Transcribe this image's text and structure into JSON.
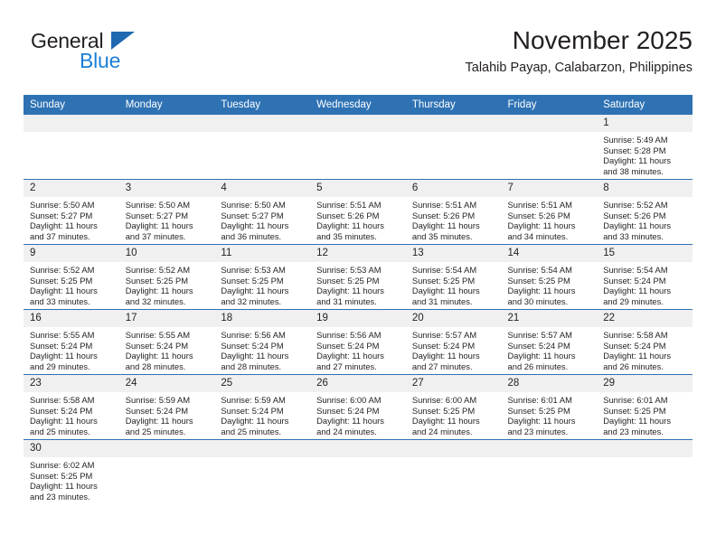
{
  "brand": {
    "name_top": "General",
    "name_bottom": "Blue",
    "triangle_color": "#1e69b0",
    "blue_text_color": "#1b7fd4"
  },
  "header": {
    "month_title": "November 2025",
    "location": "Talahib Payap, Calabarzon, Philippines",
    "accent_color": "#2e72b4"
  },
  "calendar": {
    "weekday_headers": [
      "Sunday",
      "Monday",
      "Tuesday",
      "Wednesday",
      "Thursday",
      "Friday",
      "Saturday"
    ],
    "weeks": [
      [
        {
          "day": "",
          "sunrise": "",
          "sunset": "",
          "daylight": ""
        },
        {
          "day": "",
          "sunrise": "",
          "sunset": "",
          "daylight": ""
        },
        {
          "day": "",
          "sunrise": "",
          "sunset": "",
          "daylight": ""
        },
        {
          "day": "",
          "sunrise": "",
          "sunset": "",
          "daylight": ""
        },
        {
          "day": "",
          "sunrise": "",
          "sunset": "",
          "daylight": ""
        },
        {
          "day": "",
          "sunrise": "",
          "sunset": "",
          "daylight": ""
        },
        {
          "day": "1",
          "sunrise": "Sunrise: 5:49 AM",
          "sunset": "Sunset: 5:28 PM",
          "daylight": "Daylight: 11 hours and 38 minutes."
        }
      ],
      [
        {
          "day": "2",
          "sunrise": "Sunrise: 5:50 AM",
          "sunset": "Sunset: 5:27 PM",
          "daylight": "Daylight: 11 hours and 37 minutes."
        },
        {
          "day": "3",
          "sunrise": "Sunrise: 5:50 AM",
          "sunset": "Sunset: 5:27 PM",
          "daylight": "Daylight: 11 hours and 37 minutes."
        },
        {
          "day": "4",
          "sunrise": "Sunrise: 5:50 AM",
          "sunset": "Sunset: 5:27 PM",
          "daylight": "Daylight: 11 hours and 36 minutes."
        },
        {
          "day": "5",
          "sunrise": "Sunrise: 5:51 AM",
          "sunset": "Sunset: 5:26 PM",
          "daylight": "Daylight: 11 hours and 35 minutes."
        },
        {
          "day": "6",
          "sunrise": "Sunrise: 5:51 AM",
          "sunset": "Sunset: 5:26 PM",
          "daylight": "Daylight: 11 hours and 35 minutes."
        },
        {
          "day": "7",
          "sunrise": "Sunrise: 5:51 AM",
          "sunset": "Sunset: 5:26 PM",
          "daylight": "Daylight: 11 hours and 34 minutes."
        },
        {
          "day": "8",
          "sunrise": "Sunrise: 5:52 AM",
          "sunset": "Sunset: 5:26 PM",
          "daylight": "Daylight: 11 hours and 33 minutes."
        }
      ],
      [
        {
          "day": "9",
          "sunrise": "Sunrise: 5:52 AM",
          "sunset": "Sunset: 5:25 PM",
          "daylight": "Daylight: 11 hours and 33 minutes."
        },
        {
          "day": "10",
          "sunrise": "Sunrise: 5:52 AM",
          "sunset": "Sunset: 5:25 PM",
          "daylight": "Daylight: 11 hours and 32 minutes."
        },
        {
          "day": "11",
          "sunrise": "Sunrise: 5:53 AM",
          "sunset": "Sunset: 5:25 PM",
          "daylight": "Daylight: 11 hours and 32 minutes."
        },
        {
          "day": "12",
          "sunrise": "Sunrise: 5:53 AM",
          "sunset": "Sunset: 5:25 PM",
          "daylight": "Daylight: 11 hours and 31 minutes."
        },
        {
          "day": "13",
          "sunrise": "Sunrise: 5:54 AM",
          "sunset": "Sunset: 5:25 PM",
          "daylight": "Daylight: 11 hours and 31 minutes."
        },
        {
          "day": "14",
          "sunrise": "Sunrise: 5:54 AM",
          "sunset": "Sunset: 5:25 PM",
          "daylight": "Daylight: 11 hours and 30 minutes."
        },
        {
          "day": "15",
          "sunrise": "Sunrise: 5:54 AM",
          "sunset": "Sunset: 5:24 PM",
          "daylight": "Daylight: 11 hours and 29 minutes."
        }
      ],
      [
        {
          "day": "16",
          "sunrise": "Sunrise: 5:55 AM",
          "sunset": "Sunset: 5:24 PM",
          "daylight": "Daylight: 11 hours and 29 minutes."
        },
        {
          "day": "17",
          "sunrise": "Sunrise: 5:55 AM",
          "sunset": "Sunset: 5:24 PM",
          "daylight": "Daylight: 11 hours and 28 minutes."
        },
        {
          "day": "18",
          "sunrise": "Sunrise: 5:56 AM",
          "sunset": "Sunset: 5:24 PM",
          "daylight": "Daylight: 11 hours and 28 minutes."
        },
        {
          "day": "19",
          "sunrise": "Sunrise: 5:56 AM",
          "sunset": "Sunset: 5:24 PM",
          "daylight": "Daylight: 11 hours and 27 minutes."
        },
        {
          "day": "20",
          "sunrise": "Sunrise: 5:57 AM",
          "sunset": "Sunset: 5:24 PM",
          "daylight": "Daylight: 11 hours and 27 minutes."
        },
        {
          "day": "21",
          "sunrise": "Sunrise: 5:57 AM",
          "sunset": "Sunset: 5:24 PM",
          "daylight": "Daylight: 11 hours and 26 minutes."
        },
        {
          "day": "22",
          "sunrise": "Sunrise: 5:58 AM",
          "sunset": "Sunset: 5:24 PM",
          "daylight": "Daylight: 11 hours and 26 minutes."
        }
      ],
      [
        {
          "day": "23",
          "sunrise": "Sunrise: 5:58 AM",
          "sunset": "Sunset: 5:24 PM",
          "daylight": "Daylight: 11 hours and 25 minutes."
        },
        {
          "day": "24",
          "sunrise": "Sunrise: 5:59 AM",
          "sunset": "Sunset: 5:24 PM",
          "daylight": "Daylight: 11 hours and 25 minutes."
        },
        {
          "day": "25",
          "sunrise": "Sunrise: 5:59 AM",
          "sunset": "Sunset: 5:24 PM",
          "daylight": "Daylight: 11 hours and 25 minutes."
        },
        {
          "day": "26",
          "sunrise": "Sunrise: 6:00 AM",
          "sunset": "Sunset: 5:24 PM",
          "daylight": "Daylight: 11 hours and 24 minutes."
        },
        {
          "day": "27",
          "sunrise": "Sunrise: 6:00 AM",
          "sunset": "Sunset: 5:25 PM",
          "daylight": "Daylight: 11 hours and 24 minutes."
        },
        {
          "day": "28",
          "sunrise": "Sunrise: 6:01 AM",
          "sunset": "Sunset: 5:25 PM",
          "daylight": "Daylight: 11 hours and 23 minutes."
        },
        {
          "day": "29",
          "sunrise": "Sunrise: 6:01 AM",
          "sunset": "Sunset: 5:25 PM",
          "daylight": "Daylight: 11 hours and 23 minutes."
        }
      ],
      [
        {
          "day": "30",
          "sunrise": "Sunrise: 6:02 AM",
          "sunset": "Sunset: 5:25 PM",
          "daylight": "Daylight: 11 hours and 23 minutes."
        },
        {
          "day": "",
          "sunrise": "",
          "sunset": "",
          "daylight": ""
        },
        {
          "day": "",
          "sunrise": "",
          "sunset": "",
          "daylight": ""
        },
        {
          "day": "",
          "sunrise": "",
          "sunset": "",
          "daylight": ""
        },
        {
          "day": "",
          "sunrise": "",
          "sunset": "",
          "daylight": ""
        },
        {
          "day": "",
          "sunrise": "",
          "sunset": "",
          "daylight": ""
        },
        {
          "day": "",
          "sunrise": "",
          "sunset": "",
          "daylight": ""
        }
      ]
    ]
  }
}
